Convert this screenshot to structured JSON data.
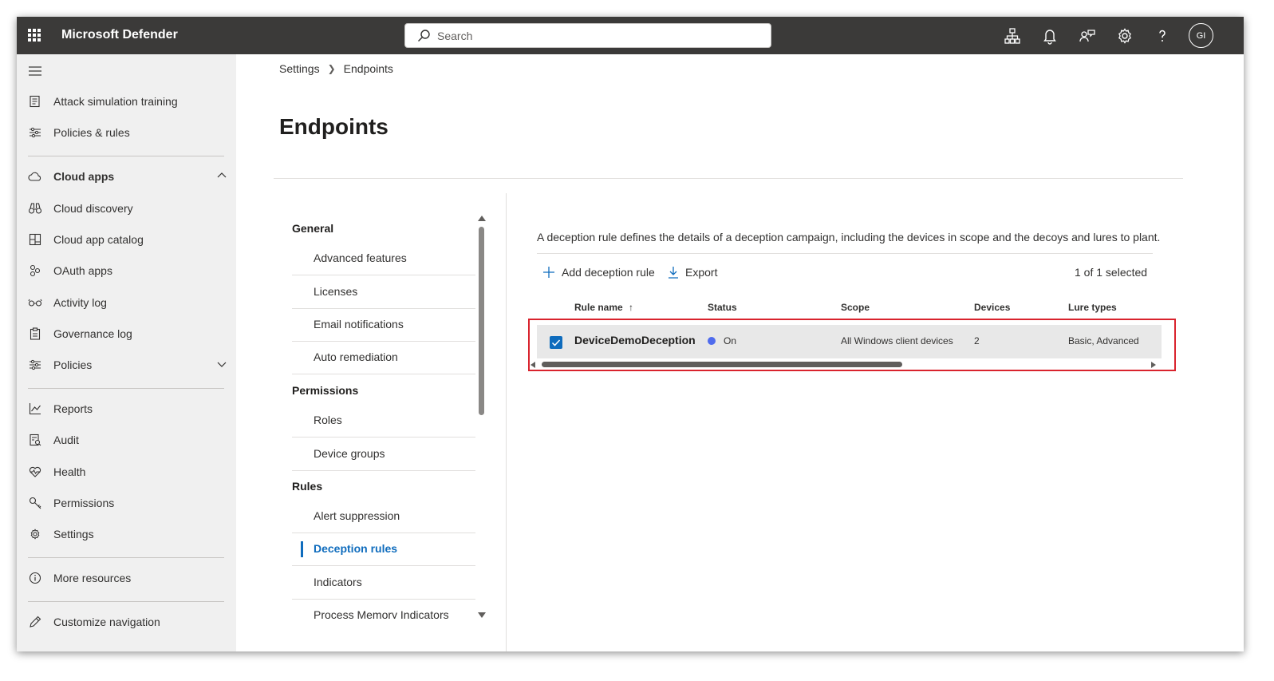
{
  "app": {
    "title": "Microsoft Defender"
  },
  "search": {
    "placeholder": "Search"
  },
  "user": {
    "initials": "GI"
  },
  "sidebar": {
    "items": [
      {
        "label": "Attack simulation training",
        "icon": "document-list-icon"
      },
      {
        "label": "Policies & rules",
        "icon": "sliders-icon"
      },
      {
        "label": "Cloud apps",
        "icon": "cloud-icon",
        "expanded": true
      },
      {
        "label": "Cloud discovery",
        "icon": "binoculars-icon"
      },
      {
        "label": "Cloud app catalog",
        "icon": "grid-icon"
      },
      {
        "label": "OAuth apps",
        "icon": "people-icon"
      },
      {
        "label": "Activity log",
        "icon": "glasses-icon"
      },
      {
        "label": "Governance log",
        "icon": "clipboard-icon"
      },
      {
        "label": "Policies",
        "icon": "sliders-icon",
        "expanded": false
      },
      {
        "label": "Reports",
        "icon": "chart-icon"
      },
      {
        "label": "Audit",
        "icon": "audit-icon"
      },
      {
        "label": "Health",
        "icon": "heart-icon"
      },
      {
        "label": "Permissions",
        "icon": "key-icon"
      },
      {
        "label": "Settings",
        "icon": "gear-icon"
      },
      {
        "label": "More resources",
        "icon": "info-icon"
      },
      {
        "label": "Customize navigation",
        "icon": "pencil-icon"
      }
    ]
  },
  "breadcrumb": {
    "items": [
      "Settings",
      "Endpoints"
    ]
  },
  "page": {
    "title": "Endpoints"
  },
  "subnav": {
    "sections": [
      {
        "heading": "General",
        "items": [
          "Advanced features",
          "Licenses",
          "Email notifications",
          "Auto remediation"
        ]
      },
      {
        "heading": "Permissions",
        "items": [
          "Roles",
          "Device groups"
        ]
      },
      {
        "heading": "Rules",
        "items": [
          "Alert suppression",
          "Deception rules",
          "Indicators",
          "Process Memory Indicators"
        ]
      }
    ],
    "active": "Deception rules"
  },
  "content": {
    "description": "A deception rule defines the details of a deception campaign, including the devices in scope and the decoys and lures to plant.",
    "toolbar": {
      "add_label": "Add deception rule",
      "export_label": "Export",
      "selected_count": "1 of 1 selected"
    },
    "table": {
      "columns": [
        "Rule name",
        "Status",
        "Scope",
        "Devices",
        "Lure types"
      ],
      "sort": {
        "column": "Rule name",
        "direction": "ascending"
      },
      "rows": [
        {
          "name": "DeviceDemoDeception",
          "status": "On",
          "scope": "All Windows client devices",
          "devices": "2",
          "lure_types": "Basic, Advanced",
          "selected": true
        }
      ]
    }
  },
  "colors": {
    "topbar": "#3b3a39",
    "accent": "#0f6cbd",
    "status_on": "#4f6bed",
    "highlight": "#d9232d",
    "sidebar_bg": "#f0f0f0"
  }
}
